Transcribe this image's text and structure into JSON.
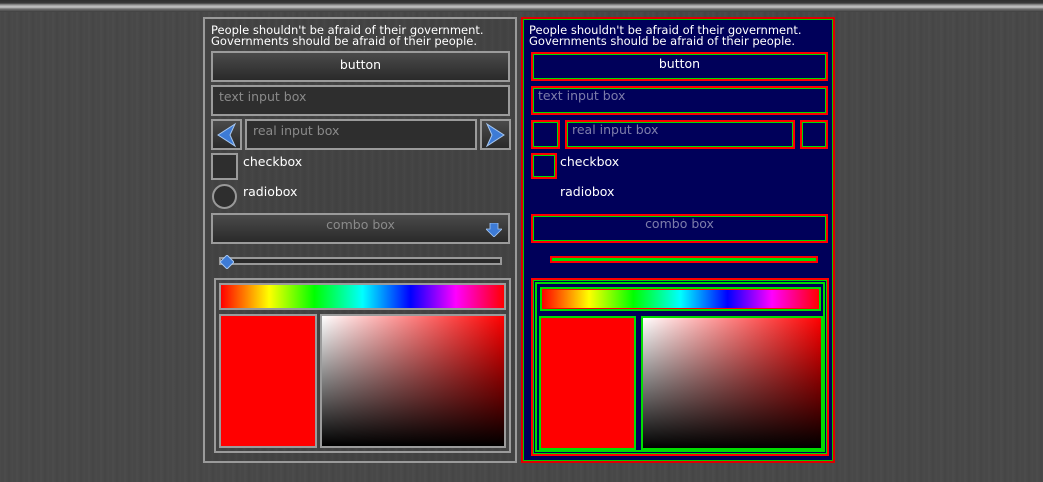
{
  "quote_line1": "People shouldn't be afraid of their government.",
  "quote_line2": "Governments should be afraid of their people.",
  "button_label": "button",
  "text_input_placeholder": "text input box",
  "real_input_placeholder": "real input box",
  "checkbox_label": "checkbox",
  "radiobox_label": "radiobox",
  "combo_placeholder": "combo box",
  "slider_value": 0,
  "colors": {
    "left_panel_border": "#9a9a9a",
    "right_panel_bg": "#00005a",
    "debug_outer": "#ff0000",
    "debug_inner": "#00dd00",
    "selected_color": "#ff0000"
  }
}
